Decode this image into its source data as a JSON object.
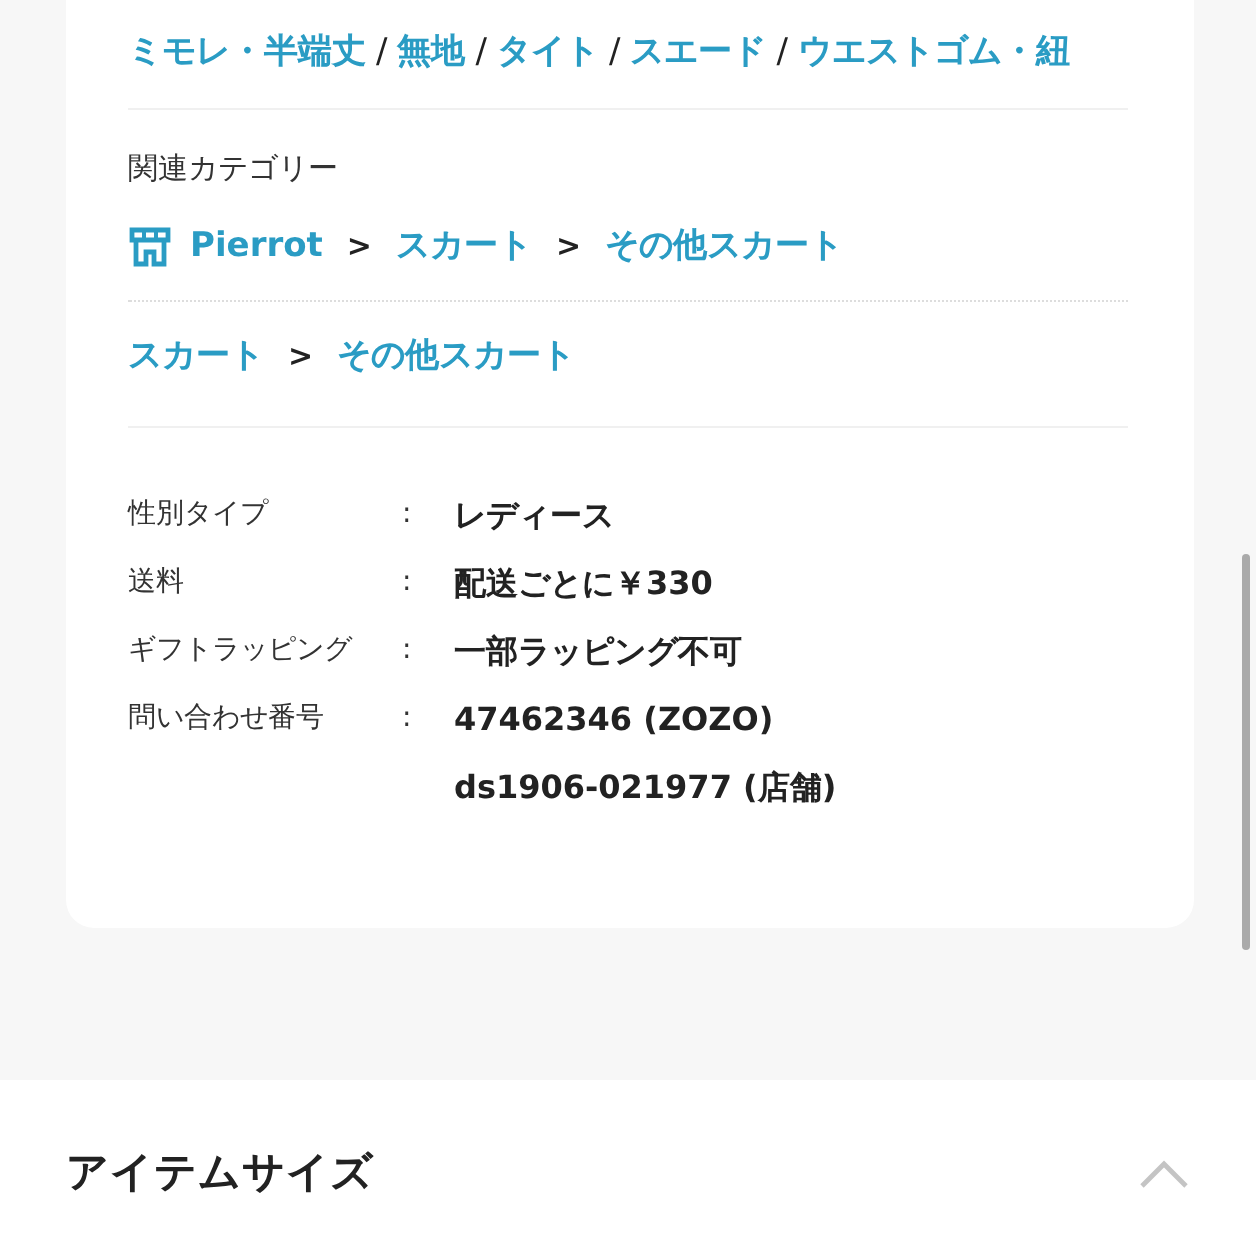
{
  "tags": [
    {
      "kind": "link",
      "text": "ミモレ・半端丈"
    },
    {
      "kind": "separator",
      "text": "/"
    },
    {
      "kind": "link",
      "text": "無地"
    },
    {
      "kind": "separator",
      "text": "/"
    },
    {
      "kind": "link",
      "text": "タイト"
    },
    {
      "kind": "separator",
      "text": "/"
    },
    {
      "kind": "link",
      "text": "スエード"
    },
    {
      "kind": "separator",
      "text": "/"
    },
    {
      "kind": "link",
      "text": "ウエストゴム・紐"
    }
  ],
  "related": {
    "heading": "関連カテゴリー",
    "paths": [
      [
        {
          "kind": "shop",
          "text": "Pierrot"
        },
        {
          "kind": "separator",
          "text": ">"
        },
        {
          "kind": "link",
          "text": "スカート"
        },
        {
          "kind": "separator",
          "text": ">"
        },
        {
          "kind": "link",
          "text": "その他スカート"
        }
      ],
      [
        {
          "kind": "link",
          "text": "スカート"
        },
        {
          "kind": "separator",
          "text": ">"
        },
        {
          "kind": "link",
          "text": "その他スカート"
        }
      ]
    ]
  },
  "specs": [
    {
      "label": "性別タイプ",
      "colon": ":",
      "values": [
        "レディース"
      ]
    },
    {
      "label": "送料",
      "colon": ":",
      "values": [
        "配送ごとに￥330"
      ]
    },
    {
      "label": "ギフトラッピング",
      "colon": ":",
      "values": [
        "一部ラッピング不可"
      ]
    },
    {
      "label": "問い合わせ番号",
      "colon": ":",
      "values": [
        "47462346 (ZOZO)",
        "ds1906-021977 (店舗)"
      ]
    }
  ],
  "item_size": {
    "title": "アイテムサイズ",
    "expanded": true
  }
}
